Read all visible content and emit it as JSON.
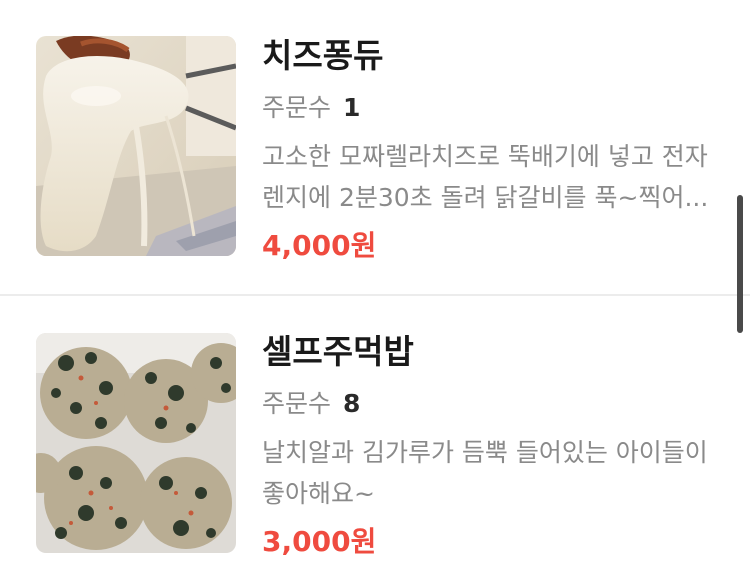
{
  "menu": {
    "items": [
      {
        "image_alt": "치즈퐁듀",
        "name": "치즈퐁듀",
        "orders_label": "주문수",
        "orders_count": "1",
        "description": "고소한 모짜렐라치즈로 뚝배기에 넣고 전자렌지에 2분30초 돌려 닭갈비를 푹~찍어...",
        "price": "4,000원"
      },
      {
        "image_alt": "셀프주먹밥",
        "name": "셀프주먹밥",
        "orders_label": "주문수",
        "orders_count": "8",
        "description": "날치알과 김가루가 듬뿍 들어있는 아이들이 좋아해요~",
        "price": "3,000원"
      }
    ]
  },
  "colors": {
    "price": "#ef4b3f",
    "muted_text": "#8a8a8a",
    "title_text": "#1a1a1a",
    "divider": "#ececec"
  }
}
